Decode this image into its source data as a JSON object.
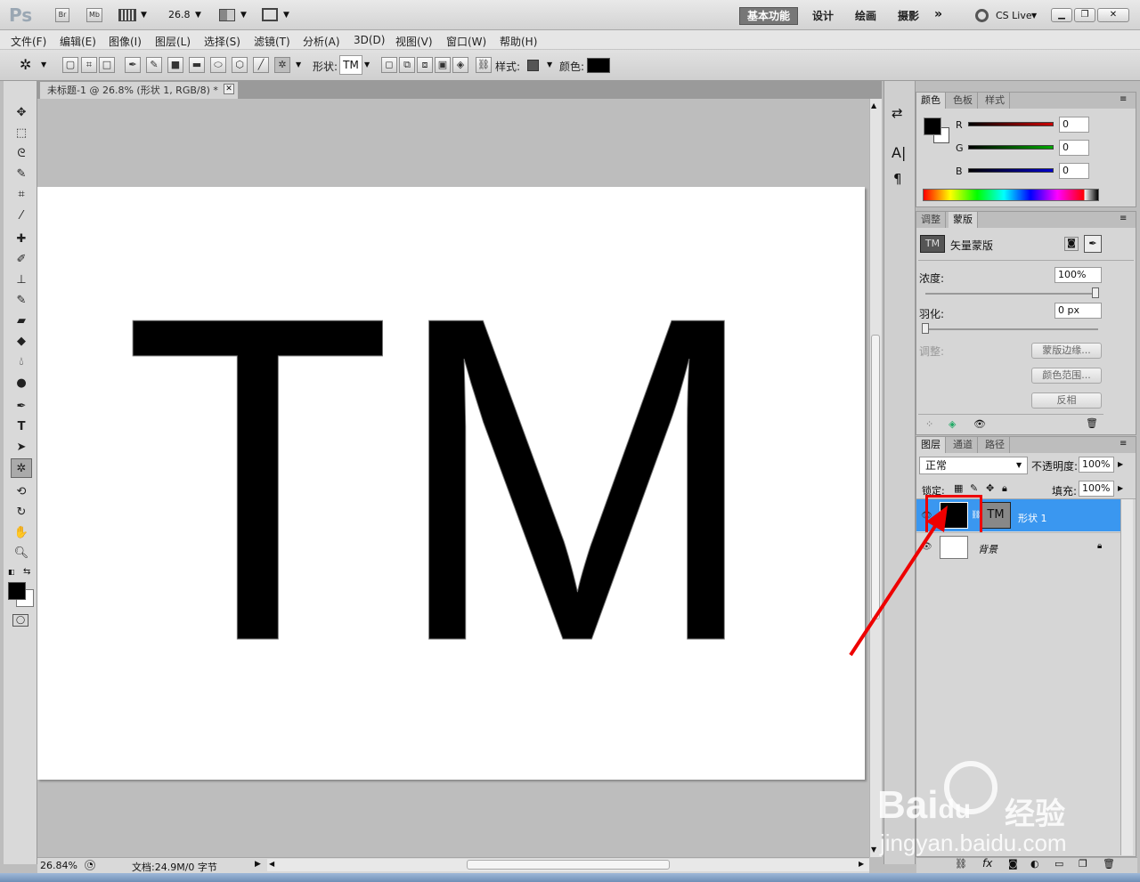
{
  "app": {
    "logo": "Ps",
    "br": "Br",
    "mb": "Mb",
    "zoom": "26.8",
    "cs_live": "CS Live"
  },
  "workspaces": [
    "基本功能",
    "设计",
    "绘画",
    "摄影"
  ],
  "menu": [
    "文件(F)",
    "编辑(E)",
    "图像(I)",
    "图层(L)",
    "选择(S)",
    "滤镜(T)",
    "分析(A)",
    "3D(D)",
    "视图(V)",
    "窗口(W)",
    "帮助(H)"
  ],
  "options": {
    "shape_label": "形状:",
    "shape_value": "TM",
    "style_label": "样式:",
    "color_label": "颜色:",
    "color": "#000000"
  },
  "document": {
    "tab": "未标题-1 @ 26.8% (形状 1, RGB/8) *",
    "canvas_text": "TM",
    "zoom_status": "26.84%",
    "doc_status": "文档:24.9M/0 字节"
  },
  "color_panel": {
    "tabs": [
      "颜色",
      "色板",
      "样式"
    ],
    "channels": [
      {
        "label": "R",
        "value": "0",
        "color": "#cc0000"
      },
      {
        "label": "G",
        "value": "0",
        "color": "#00aa00"
      },
      {
        "label": "B",
        "value": "0",
        "color": "#0000cc"
      }
    ]
  },
  "mask_panel": {
    "tabs": [
      "调整",
      "蒙版"
    ],
    "title": "矢量蒙版",
    "density_label": "浓度:",
    "density": "100%",
    "feather_label": "羽化:",
    "feather": "0 px",
    "adjust_label": "调整:",
    "buttons": [
      "蒙版边缘...",
      "颜色范围...",
      "反相"
    ]
  },
  "layers_panel": {
    "tabs": [
      "图层",
      "通道",
      "路径"
    ],
    "blend": "正常",
    "opacity_label": "不透明度:",
    "opacity": "100%",
    "lock_label": "锁定:",
    "fill_label": "填充:",
    "fill": "100%",
    "layers": [
      {
        "name": "形状 1",
        "selected": true,
        "mask_text": "TM"
      },
      {
        "name": "背景",
        "selected": false
      }
    ]
  },
  "watermark": {
    "brand": "Bai",
    "brand2": "du",
    "suffix": "经验",
    "url": "jingyan.baidu.com"
  }
}
